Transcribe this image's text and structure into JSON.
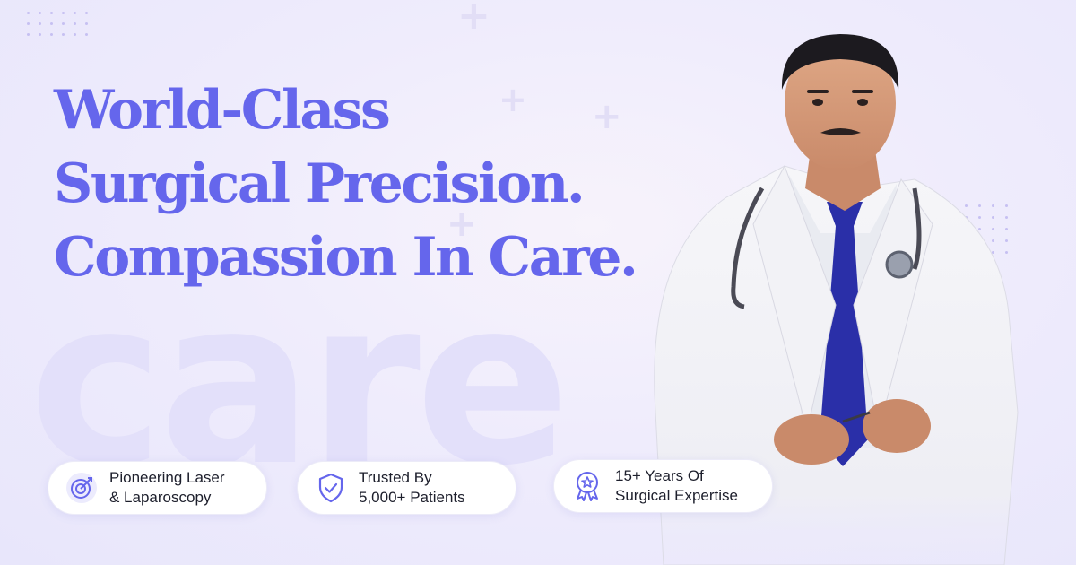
{
  "headline": {
    "line1": "World-Class",
    "line2": "Surgical Precision.",
    "line3": "Compassion In Care."
  },
  "background_word": "care",
  "features": [
    {
      "icon": "target-icon",
      "line1": "Pioneering Laser",
      "line2": "& Laparoscopy"
    },
    {
      "icon": "shield-check-icon",
      "line1": "Trusted By",
      "line2": "5,000+ Patients"
    },
    {
      "icon": "award-badge-icon",
      "line1": "15+ Years Of",
      "line2": "Surgical Expertise"
    }
  ],
  "colors": {
    "accent": "#6566ec",
    "background": "#efecfc",
    "pill_background": "#ffffff",
    "text_dark": "#1d1f2c",
    "tie": "#2a2fa8",
    "coat": "#f4f4f7"
  }
}
